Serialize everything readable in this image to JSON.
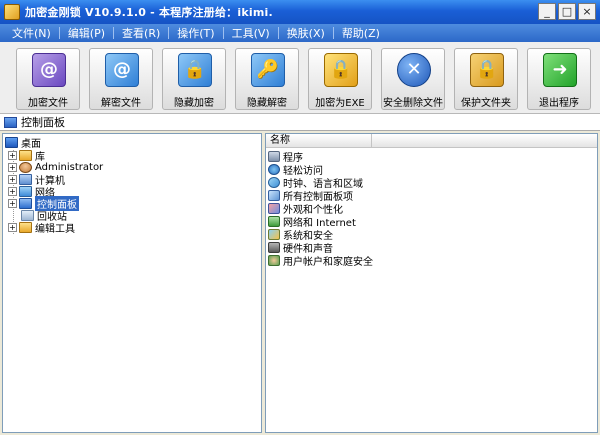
{
  "window": {
    "title": "加密金刚锁 V10.9.1.0 - 本程序注册给：ikimi.",
    "minimize_glyph": "_",
    "maximize_glyph": "□",
    "close_glyph": "×"
  },
  "menu": [
    {
      "label": "文件(N)"
    },
    {
      "label": "编辑(P)"
    },
    {
      "label": "查看(R)"
    },
    {
      "label": "操作(T)"
    },
    {
      "label": "工具(V)"
    },
    {
      "label": "换肤(X)"
    },
    {
      "label": "帮助(Z)"
    }
  ],
  "toolbar": [
    {
      "label": "加密文件",
      "icon": "encrypt-file-icon",
      "glyph": "@"
    },
    {
      "label": "解密文件",
      "icon": "decrypt-file-icon",
      "glyph": "@"
    },
    {
      "label": "隐藏加密",
      "icon": "hidden-encrypt-icon",
      "glyph": "🔒"
    },
    {
      "label": "隐藏解密",
      "icon": "hidden-decrypt-icon",
      "glyph": "🔑"
    },
    {
      "label": "加密为EXE",
      "icon": "encrypt-exe-icon",
      "glyph": "🔒"
    },
    {
      "label": "安全删除文件",
      "icon": "secure-delete-icon",
      "glyph": "✕"
    },
    {
      "label": "保护文件夹",
      "icon": "protect-folder-icon",
      "glyph": "🔒"
    },
    {
      "label": "退出程序",
      "icon": "exit-icon",
      "glyph": "➜"
    }
  ],
  "address": {
    "text": "控制面板"
  },
  "tree": {
    "root": "桌面",
    "items": [
      {
        "label": "库",
        "expander": "+",
        "icon": "library"
      },
      {
        "label": "Administrator",
        "expander": "+",
        "icon": "user"
      },
      {
        "label": "计算机",
        "expander": "+",
        "icon": "computer"
      },
      {
        "label": "网络",
        "expander": "+",
        "icon": "network"
      },
      {
        "label": "控制面板",
        "expander": "+",
        "icon": "control-panel",
        "selected": true
      },
      {
        "label": "回收站",
        "expander": "",
        "icon": "recycle-bin"
      },
      {
        "label": "编辑工具",
        "expander": "+",
        "icon": "folder"
      }
    ]
  },
  "list": {
    "column_header": "名称",
    "items": [
      {
        "label": "程序"
      },
      {
        "label": "轻松访问"
      },
      {
        "label": "时钟、语言和区域"
      },
      {
        "label": "所有控制面板项"
      },
      {
        "label": "外观和个性化"
      },
      {
        "label": "网络和 Internet"
      },
      {
        "label": "系统和安全"
      },
      {
        "label": "硬件和声音"
      },
      {
        "label": "用户帐户和家庭安全"
      }
    ]
  }
}
